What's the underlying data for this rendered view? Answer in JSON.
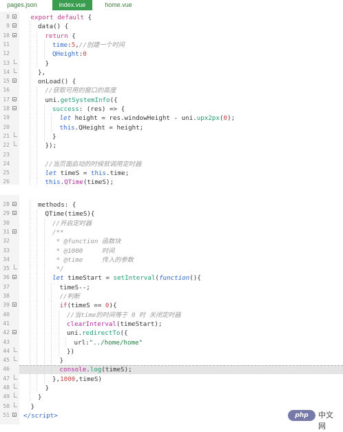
{
  "tabs": [
    {
      "label": "pages.json",
      "active": false
    },
    {
      "label": "index.vue",
      "active": true
    },
    {
      "label": "home.vue",
      "active": false
    }
  ],
  "panel1_lines": [
    {
      "n": "8",
      "fold": "open",
      "indent": 1,
      "html": "<span class='kw'>export</span> <span class='kw'>default</span> {"
    },
    {
      "n": "9",
      "fold": "open",
      "indent": 2,
      "html": "data() {"
    },
    {
      "n": "10",
      "fold": "open",
      "indent": 3,
      "html": "<span class='kw'>return</span> {"
    },
    {
      "n": "11",
      "fold": "",
      "indent": 4,
      "html": "<span class='prop'>time</span>:<span class='num'>5</span>,<span class='com'>//创建一个时间</span>"
    },
    {
      "n": "12",
      "fold": "",
      "indent": 4,
      "html": "<span class='prop'>QHeight</span>:<span class='num'>0</span>"
    },
    {
      "n": "13",
      "fold": "end",
      "indent": 3,
      "html": "}"
    },
    {
      "n": "14",
      "fold": "end",
      "indent": 2,
      "html": "},"
    },
    {
      "n": "15",
      "fold": "open",
      "indent": 2,
      "html": "onLoad() {"
    },
    {
      "n": "16",
      "fold": "",
      "indent": 3,
      "html": "<span class='com'>//获取可用的窗口的高度</span>"
    },
    {
      "n": "17",
      "fold": "open",
      "indent": 3,
      "html": "uni.<span class='func'>getSystemInfo</span>({"
    },
    {
      "n": "18",
      "fold": "open",
      "indent": 4,
      "html": "<span class='func'>success</span>: (res) => {"
    },
    {
      "n": "19",
      "fold": "",
      "indent": 5,
      "html": "<span class='it'>let</span> height = res.windowHeight - uni.<span class='func'>upx2px</span>(<span class='num'>0</span>);"
    },
    {
      "n": "20",
      "fold": "",
      "indent": 5,
      "html": "<span class='kw2'>this</span>.QHeight = height;"
    },
    {
      "n": "21",
      "fold": "end",
      "indent": 4,
      "html": "}"
    },
    {
      "n": "22",
      "fold": "end",
      "indent": 3,
      "html": "});"
    },
    {
      "n": "23",
      "fold": "",
      "indent": 3,
      "html": ""
    },
    {
      "n": "24",
      "fold": "",
      "indent": 3,
      "html": "<span class='com'>//当页面启动的时候就调用定时器</span>"
    },
    {
      "n": "25",
      "fold": "",
      "indent": 3,
      "html": "<span class='it'>let</span> timeS = <span class='kw2'>this</span>.time;"
    },
    {
      "n": "26",
      "fold": "",
      "indent": 3,
      "html": "<span class='kw2'>this</span>.<span class='fn'>QTime</span>(timeS);"
    },
    {
      "n": "27",
      "fold": "end",
      "indent": 2,
      "html": "},"
    }
  ],
  "panel2_lines": [
    {
      "n": "28",
      "fold": "open",
      "indent": 2,
      "html": "methods: {"
    },
    {
      "n": "29",
      "fold": "open",
      "indent": 3,
      "html": "QTime(timeS){"
    },
    {
      "n": "30",
      "fold": "",
      "indent": 4,
      "html": "<span class='com'>//开启定时器</span>"
    },
    {
      "n": "31",
      "fold": "open",
      "indent": 4,
      "html": "<span class='com'>/**</span>"
    },
    {
      "n": "32",
      "fold": "",
      "indent": 4,
      "html": "<span class='com'> * @function 函数块</span>"
    },
    {
      "n": "33",
      "fold": "",
      "indent": 4,
      "html": "<span class='com'> * @1000     时间</span>"
    },
    {
      "n": "34",
      "fold": "",
      "indent": 4,
      "html": "<span class='com'> * @time     传入的参数</span>"
    },
    {
      "n": "35",
      "fold": "end",
      "indent": 4,
      "html": "<span class='com'> */</span>"
    },
    {
      "n": "36",
      "fold": "open",
      "indent": 4,
      "html": "<span class='it'>let</span> timeStart = <span class='func'>setInterval</span>(<span class='it'>function</span>(){"
    },
    {
      "n": "37",
      "fold": "",
      "indent": 5,
      "html": "timeS--;"
    },
    {
      "n": "38",
      "fold": "",
      "indent": 5,
      "html": "<span class='com'>//判断</span>"
    },
    {
      "n": "39",
      "fold": "open",
      "indent": 5,
      "html": "<span class='kw'>if</span>(timeS == <span class='num'>0</span>){"
    },
    {
      "n": "40",
      "fold": "",
      "indent": 6,
      "html": "<span class='com'>//当time的时间等于 0 时 关闭定时器</span>"
    },
    {
      "n": "41",
      "fold": "",
      "indent": 6,
      "html": "<span class='fn'>clearInterval</span>(timeStart);"
    },
    {
      "n": "42",
      "fold": "open",
      "indent": 6,
      "html": "uni.<span class='func'>redirectTo</span>({"
    },
    {
      "n": "43",
      "fold": "",
      "indent": 7,
      "html": "url:<span class='str'>\"../home/home\"</span>"
    },
    {
      "n": "44",
      "fold": "end",
      "indent": 6,
      "html": "})"
    },
    {
      "n": "45",
      "fold": "end",
      "indent": 5,
      "html": "}"
    },
    {
      "n": "46",
      "fold": "",
      "indent": 5,
      "html": "<span class='fn'>console</span>.<span class='func'>log</span>(timeS);",
      "highlight": true
    },
    {
      "n": "47",
      "fold": "end",
      "indent": 4,
      "html": "},<span class='num'>1000</span>,timeS)"
    },
    {
      "n": "48",
      "fold": "end",
      "indent": 3,
      "html": "}"
    },
    {
      "n": "49",
      "fold": "end",
      "indent": 2,
      "html": "}"
    },
    {
      "n": "50",
      "fold": "end",
      "indent": 1,
      "html": "}"
    },
    {
      "n": "51",
      "fold": "open",
      "indent": 0,
      "html": "<span class='kw2'>&lt;/script&gt;</span>"
    }
  ],
  "watermark": {
    "logo": "php",
    "text": "中文网"
  }
}
